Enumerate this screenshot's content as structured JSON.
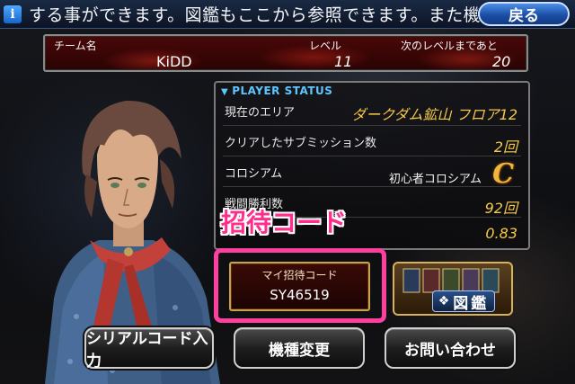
{
  "ticker": {
    "text": "する事ができます。図鑑もここから参照できます。また機種",
    "back_label": "戻る"
  },
  "team": {
    "name_label": "チーム名",
    "name_value": "KiDD",
    "level_label": "レベル",
    "level_value": "11",
    "next_label": "次のレベルまであと",
    "next_value": "20"
  },
  "player_status": {
    "header": "PLAYER STATUS",
    "rows": [
      {
        "label": "現在のエリア",
        "value": "ダークダム鉱山 フロア12"
      },
      {
        "label": "クリアしたサブミッション数",
        "value": "2回"
      },
      {
        "label": "コロシアム",
        "value": "初心者コロシアム",
        "rank": "C"
      },
      {
        "label": "戦闘勝利数",
        "value": "92回"
      },
      {
        "label": "",
        "value": "0.83"
      }
    ]
  },
  "annotation": {
    "label": "招待コード"
  },
  "invite": {
    "label": "マイ招待コード",
    "code": "SY46519"
  },
  "zukan": {
    "label": "図鑑"
  },
  "buttons": {
    "serial": "シリアルコード入力",
    "device": "機種変更",
    "contact": "お問い合わせ"
  },
  "colors": {
    "accent_pink": "#ff2d8c",
    "status_value": "#f4c84a",
    "header_blue": "#5ec6ff"
  }
}
